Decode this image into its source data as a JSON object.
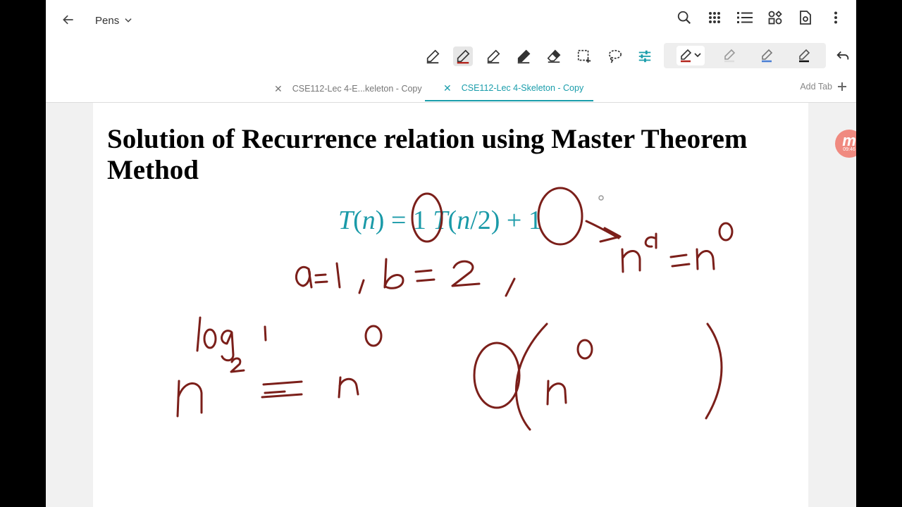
{
  "header": {
    "title": "Pens",
    "back_icon": "arrow-left-icon",
    "top_icons": [
      "search-icon",
      "grid-dots-icon",
      "list-icon",
      "shapes-icon",
      "page-settings-icon",
      "more-vert-icon"
    ]
  },
  "toolbar": {
    "tools": [
      "pen-icon",
      "highlighter-red-icon",
      "pen-icon",
      "pen-icon",
      "eraser-icon",
      "lasso-select-icon",
      "lasso-icon",
      "sliders-icon"
    ],
    "active_tool": 1,
    "pens": [
      "pen-red-icon",
      "pencil-icon",
      "pen-blue-icon",
      "pen-black-icon"
    ],
    "undo_icon": "undo-icon"
  },
  "tabs": {
    "items": [
      {
        "label": "CSE112-Lec 4-E...keleton - Copy",
        "active": false
      },
      {
        "label": "CSE112-Lec 4-Skeleton - Copy",
        "active": true
      }
    ],
    "add_label": "Add Tab"
  },
  "page": {
    "heading": "Solution of Recurrence relation using Master Theorem Method",
    "equation": {
      "T": "T",
      "n1": "n",
      "eq": "=",
      "a": "1",
      "T2": "T",
      "n2": "n",
      "b": "/2",
      "plus": "+",
      "f": "1"
    },
    "handwriting": "a=1, b=2, n^d = n^0, n^(log_2 1) = n^0, O(n^0)"
  },
  "avatar": {
    "letter": "m",
    "time": "09:46"
  },
  "colors": {
    "accent": "#1a9dab",
    "ink": "#7b1f1a",
    "avatar": "#f08a80"
  }
}
